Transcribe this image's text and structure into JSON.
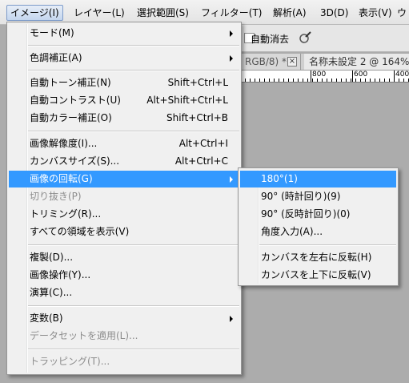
{
  "menubar": {
    "items": [
      {
        "label": "イメージ(I)",
        "active": true
      },
      {
        "label": "レイヤー(L)"
      },
      {
        "label": "選択範囲(S)"
      },
      {
        "label": "フィルター(T)"
      },
      {
        "label": "解析(A)"
      },
      {
        "label": "3D(D)"
      },
      {
        "label": "表示(V)"
      },
      {
        "label": "ウ"
      }
    ]
  },
  "options_bar": {
    "auto_erase_label": "自動消去",
    "brush_icon": "brush-settings-icon"
  },
  "document_tabs": {
    "tab1_label": "RGB/8) *",
    "tab1_close": "×",
    "tab2_label": "名称未設定 2 @ 164%"
  },
  "ruler": {
    "labels": [
      "800",
      "600",
      "400"
    ]
  },
  "image_menu": {
    "items": [
      {
        "label": "モード(M)",
        "submenu": true
      },
      {
        "label": "色調補正(A)",
        "submenu": true
      },
      {
        "label": "自動トーン補正(N)",
        "shortcut": "Shift+Ctrl+L"
      },
      {
        "label": "自動コントラスト(U)",
        "shortcut": "Alt+Shift+Ctrl+L"
      },
      {
        "label": "自動カラー補正(O)",
        "shortcut": "Shift+Ctrl+B"
      },
      {
        "label": "画像解像度(I)...",
        "shortcut": "Alt+Ctrl+I"
      },
      {
        "label": "カンバスサイズ(S)...",
        "shortcut": "Alt+Ctrl+C"
      },
      {
        "label": "画像の回転(G)",
        "submenu": true,
        "highlighted": true
      },
      {
        "label": "切り抜き(P)",
        "disabled": true
      },
      {
        "label": "トリミング(R)..."
      },
      {
        "label": "すべての領域を表示(V)"
      },
      {
        "label": "複製(D)..."
      },
      {
        "label": "画像操作(Y)..."
      },
      {
        "label": "演算(C)..."
      },
      {
        "label": "変数(B)",
        "submenu": true
      },
      {
        "label": "データセットを適用(L)...",
        "disabled": true
      },
      {
        "label": "トラッピング(T)...",
        "disabled": true
      }
    ]
  },
  "rotate_submenu": {
    "items": [
      {
        "label": "180°(1)",
        "highlighted": true
      },
      {
        "label": "90° (時計回り)(9)"
      },
      {
        "label": "90° (反時計回り)(0)"
      },
      {
        "label": "角度入力(A)..."
      },
      {
        "label": "カンバスを左右に反転(H)"
      },
      {
        "label": "カンバスを上下に反転(V)"
      }
    ]
  },
  "colors": {
    "highlight": "#3399ff",
    "background": "#acacac",
    "menu_bg": "#f0f0f0"
  }
}
